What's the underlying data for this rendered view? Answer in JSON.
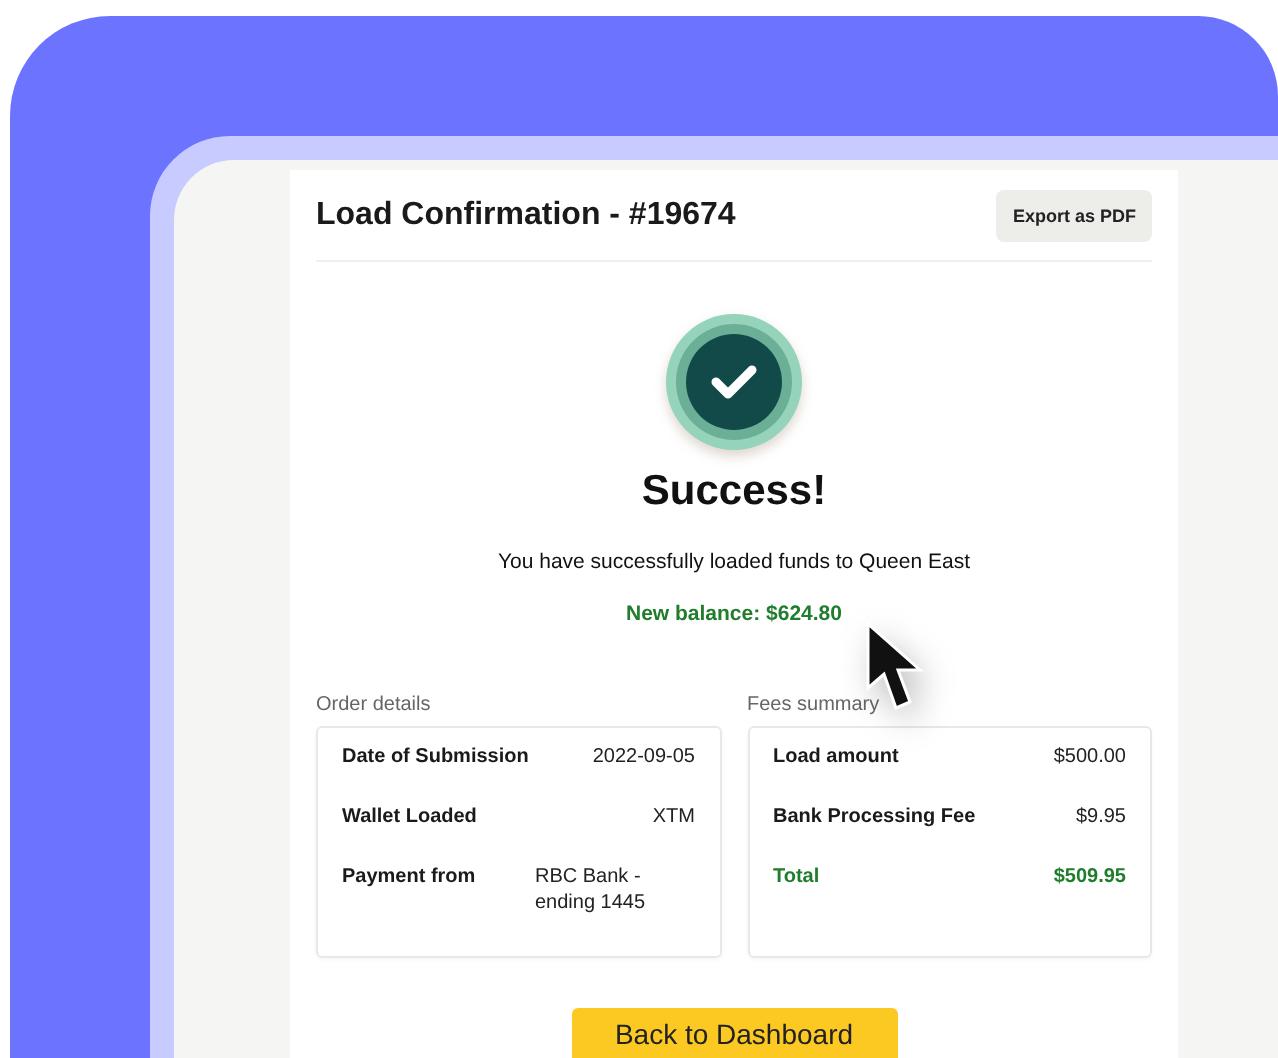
{
  "header": {
    "title": "Load Confirmation - #19674",
    "export_button": "Export as PDF"
  },
  "result": {
    "heading": "Success!",
    "message": "You have successfully loaded funds to Queen East",
    "balance": "New balance: $624.80"
  },
  "sections": [
    {
      "title": "Order details",
      "rows": [
        {
          "kind": "plain",
          "label": "Date of Submission",
          "value": "2022-09-05"
        },
        {
          "kind": "plain",
          "label": "Wallet Loaded",
          "value": "XTM"
        },
        {
          "kind": "plain",
          "label": "Payment from",
          "value": "RBC Bank - ending 1445"
        }
      ]
    },
    {
      "title": "Fees summary",
      "rows": [
        {
          "kind": "plain",
          "label": "Load amount",
          "value": "$500.00"
        },
        {
          "kind": "plain",
          "label": "Bank Processing Fee",
          "value": "$9.95"
        },
        {
          "kind": "total",
          "label": "Total",
          "value": "$509.95"
        }
      ]
    }
  ],
  "primary_button": "Back to Dashboard"
}
